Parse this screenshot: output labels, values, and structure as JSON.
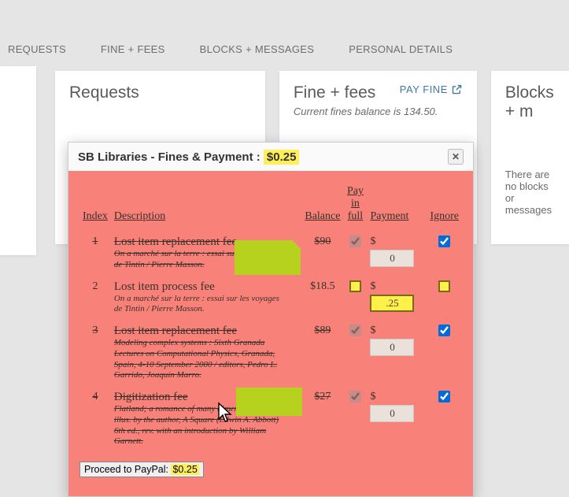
{
  "tabs": {
    "requests": "REQUESTS",
    "fines": "FINE + FEES",
    "blocks": "BLOCKS + MESSAGES",
    "personal": "PERSONAL DETAILS"
  },
  "cards": {
    "requests": {
      "title": "Requests"
    },
    "fines": {
      "title": "Fine + fees",
      "paylink": "PAY FINE",
      "subtitle_pre": "Current fines balance is ",
      "subtitle_amt": "134.50",
      "subtitle_post": "."
    },
    "blocks": {
      "title": "Blocks + m",
      "msg_line": "There are no blocks or messages"
    }
  },
  "modal": {
    "title_pre": "SB Libraries - Fines & Payment : ",
    "title_amt": "$0.25",
    "headers": {
      "index": "Index",
      "desc": "Description",
      "balance": "Balance",
      "pf_l1": "Pay",
      "pf_l2": "in",
      "pf_l3": "full",
      "payment": "Payment",
      "ignore": "Ignore"
    },
    "rows": [
      {
        "idx": "1",
        "title": "Lost item replacement fee",
        "sub": "On a marché sur la terre : essai sur les voyages de Tintin / Pierre Masson.",
        "balance": "$90",
        "struck": true,
        "pf_gray": true,
        "pay_value": "0",
        "pay_hilite": false,
        "ignore_checked": true,
        "pf_yellow": false
      },
      {
        "idx": "2",
        "title": "Lost item process fee",
        "sub": "On a marché sur la terre : essai sur les voyages de Tintin / Pierre Masson.",
        "balance": "$18.5",
        "struck": false,
        "pf_gray": false,
        "pay_value": ".25",
        "pay_hilite": true,
        "ignore_checked": false,
        "pf_yellow": true
      },
      {
        "idx": "3",
        "title": "Lost item replacement fee",
        "sub": "Modeling complex systems : Sixth Granada Lectures on Computational Physics, Granada, Spain, 4-10 September 2000 / editors, Pedro L. Garrido, Joaquín Marro.",
        "balance": "$89",
        "struck": true,
        "pf_gray": true,
        "pay_value": "0",
        "pay_hilite": false,
        "ignore_checked": true,
        "pf_yellow": false
      },
      {
        "idx": "4",
        "title": "Digitization fee",
        "sub": "Flatland; a romance of many dimensions. With illus. by the author, A Square (Edwin A. Abbott) 6th ed., rev. with an introduction by William Garnett.",
        "balance": "$27",
        "struck": true,
        "pf_gray": true,
        "pay_value": "0",
        "pay_hilite": false,
        "ignore_checked": true,
        "pf_yellow": false
      }
    ],
    "proceed_pre": "Proceed to PayPal: ",
    "proceed_amt": "$0.25"
  }
}
